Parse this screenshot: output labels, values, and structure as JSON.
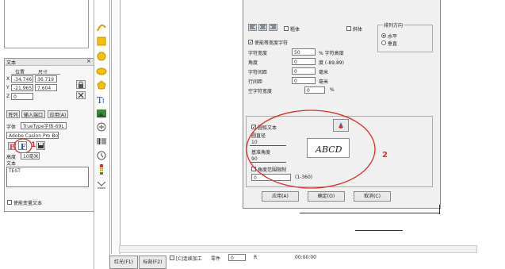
{
  "left_panel": {
    "panel_title": "文本",
    "close": "×",
    "position_label": "位置",
    "size_label": "尺寸",
    "x_label": "X",
    "x_value": "-34.746",
    "w_value": "36.719",
    "y_label": "Y",
    "y_value": "-21.965",
    "h_value": "7.604",
    "z_label": "Z",
    "z_value": "0",
    "btn_array": "阵列",
    "btn_input": "输入端口",
    "btn_apply": "应用(A)",
    "font_label": "字体",
    "font_value": "TrueType字体-69L",
    "font_name": "Adobe Caslon Pro Bold",
    "annotation_1": "1",
    "height_label": "高度",
    "height_value": "10毫米",
    "text_label": "文本",
    "text_value": "TEST",
    "use_var_text": "使能变量文本"
  },
  "dialog": {
    "arrange_dir": "排列方向",
    "horizontal": "水平",
    "vertical": "垂直",
    "bold": "粗体",
    "italic": "斜体",
    "equal_width": "使能等宽度字符",
    "char_width_label": "字符宽度",
    "char_width_value": "50",
    "char_height_label": "% 字符高度",
    "angle_label": "角度",
    "angle_value": "0",
    "angle_unit": "度 (-89,89)",
    "spacing_label": "字符间距",
    "spacing_value": "0",
    "spacing_unit": "毫米",
    "line_spacing_label": "行间距",
    "line_spacing_value": "0",
    "line_spacing_unit": "毫米",
    "space_width_label": "空字符宽度",
    "space_width_value": "0",
    "space_width_unit": "%",
    "arc_text": "圆弧文本",
    "arc_radius_label": "圆直径",
    "arc_radius_value": "10",
    "base_angle_label": "基准角度",
    "base_angle_value": "90",
    "angle_limit": "角度范围限制",
    "angle_limit_value": "0",
    "angle_limit_range": "(1-360)",
    "preview_text": "ABCD",
    "annotation_2": "2",
    "apply_btn": "应用(A)",
    "ok_btn": "确定(O)",
    "cancel_btn": "取消(C)"
  },
  "statusbar": {
    "red_btn": "红光(F1)",
    "mark_btn": "标刻(F2)",
    "continuous": "[C]连续加工",
    "part_label": "零件",
    "part_value": "0",
    "r_label": "R",
    "time": "00:00:00"
  },
  "colors": {
    "red_circle": "#d9312b",
    "blue_f": "#1f3fbf"
  }
}
